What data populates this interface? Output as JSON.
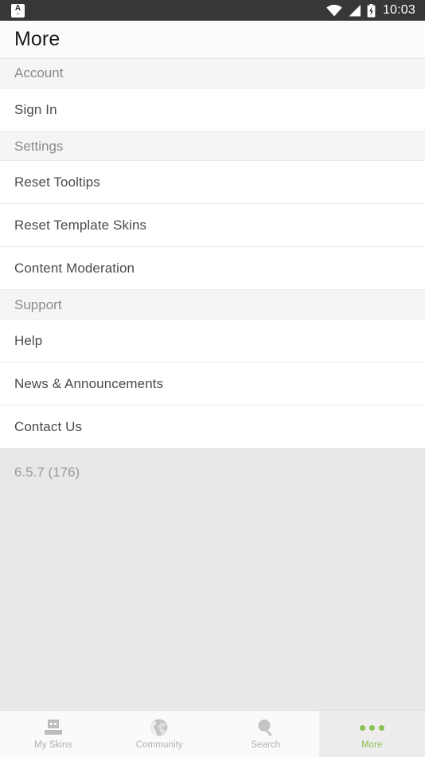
{
  "status_bar": {
    "app_badge_letter": "A",
    "app_badge_sub": "app",
    "wifi_icon": "wifi-icon",
    "signal_icon": "signal-icon",
    "battery_icon": "battery-charging-icon",
    "time": "10:03",
    "background_color": "#373737"
  },
  "header": {
    "title": "More"
  },
  "sections": [
    {
      "header": "Account",
      "items": [
        {
          "label": "Sign In"
        }
      ]
    },
    {
      "header": "Settings",
      "items": [
        {
          "label": "Reset Tooltips"
        },
        {
          "label": "Reset Template Skins"
        },
        {
          "label": "Content Moderation"
        }
      ]
    },
    {
      "header": "Support",
      "items": [
        {
          "label": "Help"
        },
        {
          "label": "News & Announcements"
        },
        {
          "label": "Contact Us"
        }
      ]
    }
  ],
  "footer": {
    "version": "6.5.7 (176)"
  },
  "bottom_nav": {
    "active_color": "#8cc152",
    "inactive_color": "#b0b0b0",
    "tabs": [
      {
        "label": "My Skins",
        "icon": "skin-head-icon",
        "active": false
      },
      {
        "label": "Community",
        "icon": "globe-icon",
        "active": false
      },
      {
        "label": "Search",
        "icon": "magnifier-icon",
        "active": false
      },
      {
        "label": "More",
        "icon": "ellipsis-icon",
        "active": true
      }
    ]
  }
}
